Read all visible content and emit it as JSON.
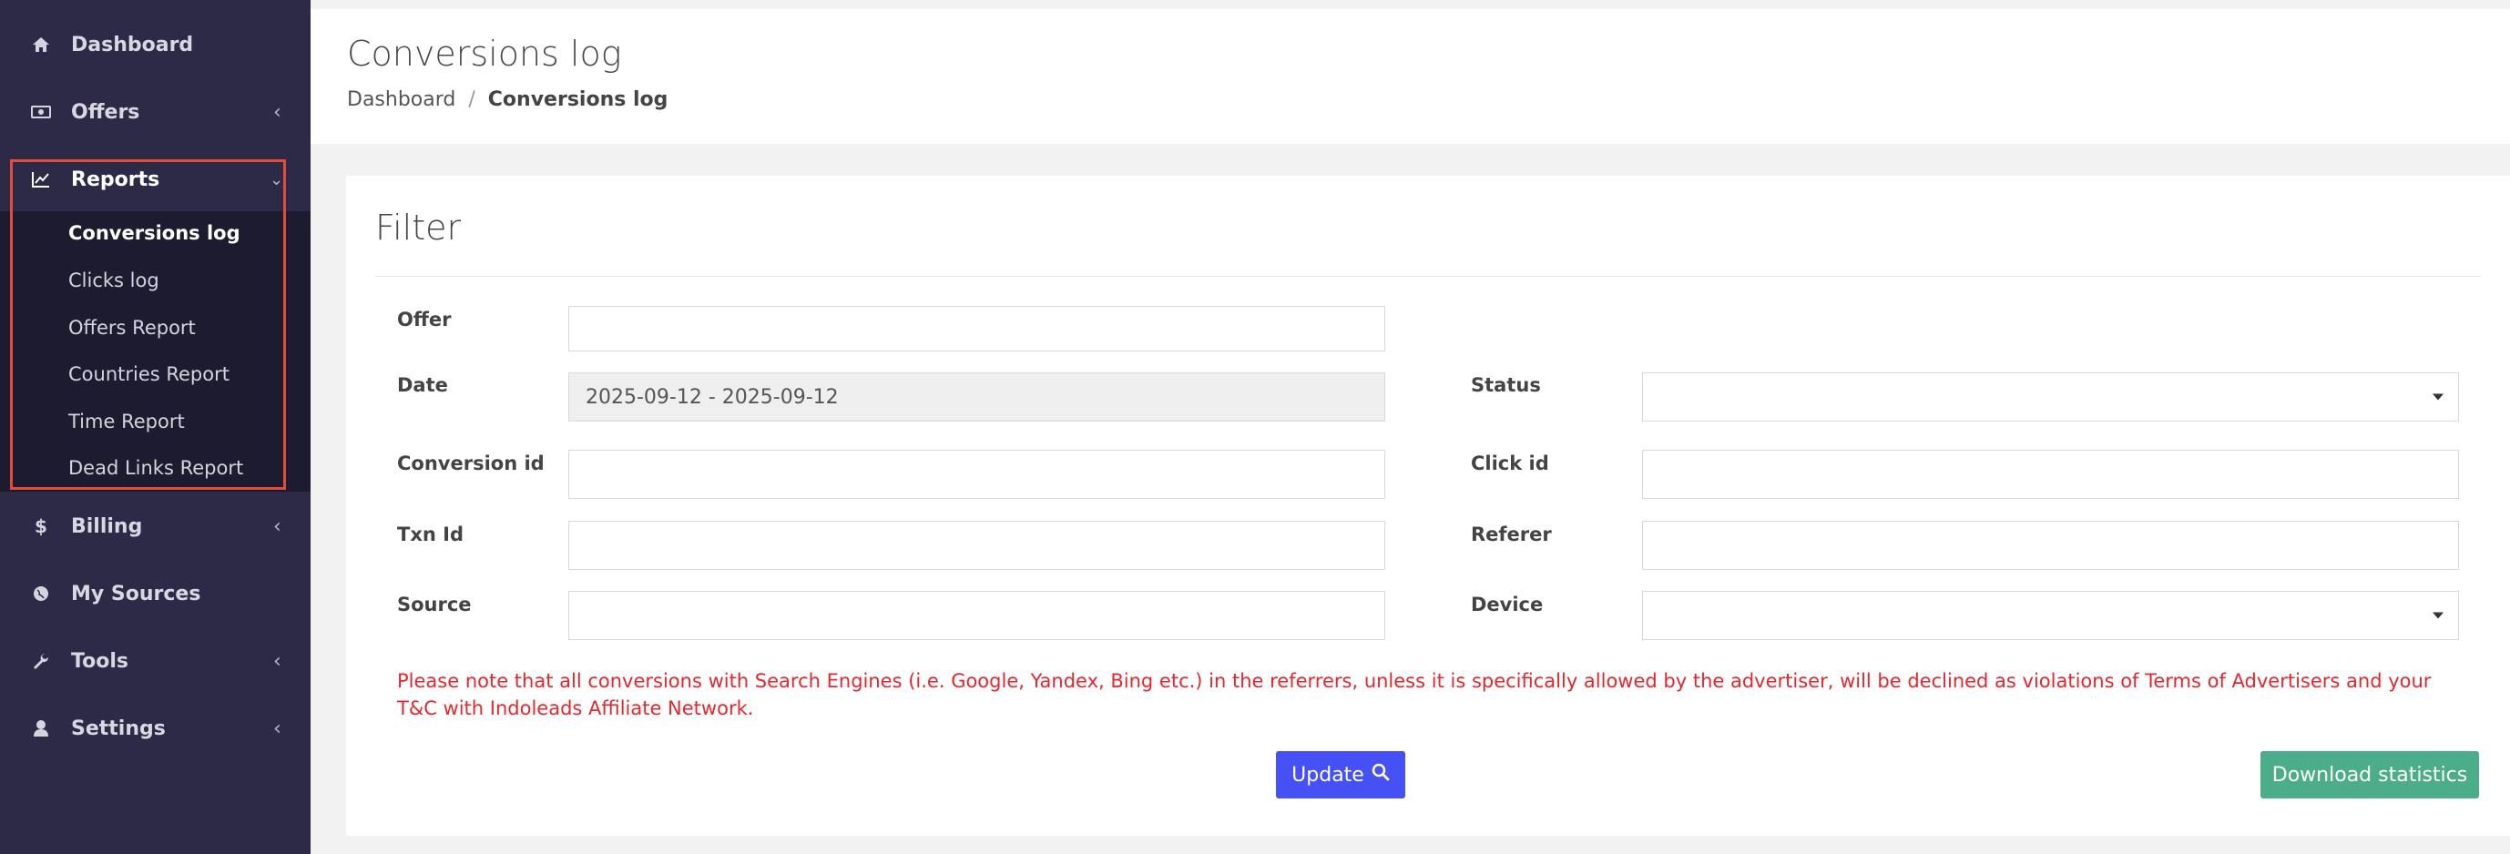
{
  "sidebar": {
    "items": [
      {
        "label": "Dashboard",
        "icon": "home-icon"
      },
      {
        "label": "Offers",
        "icon": "money-icon"
      },
      {
        "label": "Reports",
        "icon": "chart-line-icon"
      },
      {
        "label": "Billing",
        "icon": "dollar-icon"
      },
      {
        "label": "My Sources",
        "icon": "globe-icon"
      },
      {
        "label": "Tools",
        "icon": "wrench-icon"
      },
      {
        "label": "Settings",
        "icon": "user-icon"
      }
    ],
    "reports_sub": [
      "Conversions log",
      "Clicks log",
      "Offers Report",
      "Countries Report",
      "Time Report",
      "Dead Links Report"
    ],
    "highlight_color": "#e24c38"
  },
  "header": {
    "title": "Conversions log",
    "breadcrumb": {
      "home": "Dashboard",
      "separator": "/",
      "current": "Conversions log"
    }
  },
  "filter": {
    "title": "Filter",
    "offer_label": "Offer",
    "offer_value": "",
    "date_label": "Date",
    "date_value": "2025-09-12 - 2025-09-12",
    "status_label": "Status",
    "status_value": "",
    "conversion_id_label": "Conversion id",
    "click_id_label": "Click id",
    "txn_id_label": "Txn Id",
    "referer_label": "Referer",
    "source_label": "Source",
    "device_label": "Device",
    "device_value": "",
    "notice": "Please note that all conversions with Search Engines (i.e. Google, Yandex, Bing etc.) in the referrers, unless it is specifically allowed by the advertiser, will be declined as violations of Terms of Advertisers and your T&C with Indoleads Affiliate Network.",
    "update_label": "Update",
    "download_label": "Download statistics"
  },
  "colors": {
    "sidebar_bg": "#2c2a47",
    "submenu_bg": "#1d1b30",
    "update_button": "#4550f5",
    "download_button": "#4cad8a",
    "notice_text": "#e8262d"
  }
}
